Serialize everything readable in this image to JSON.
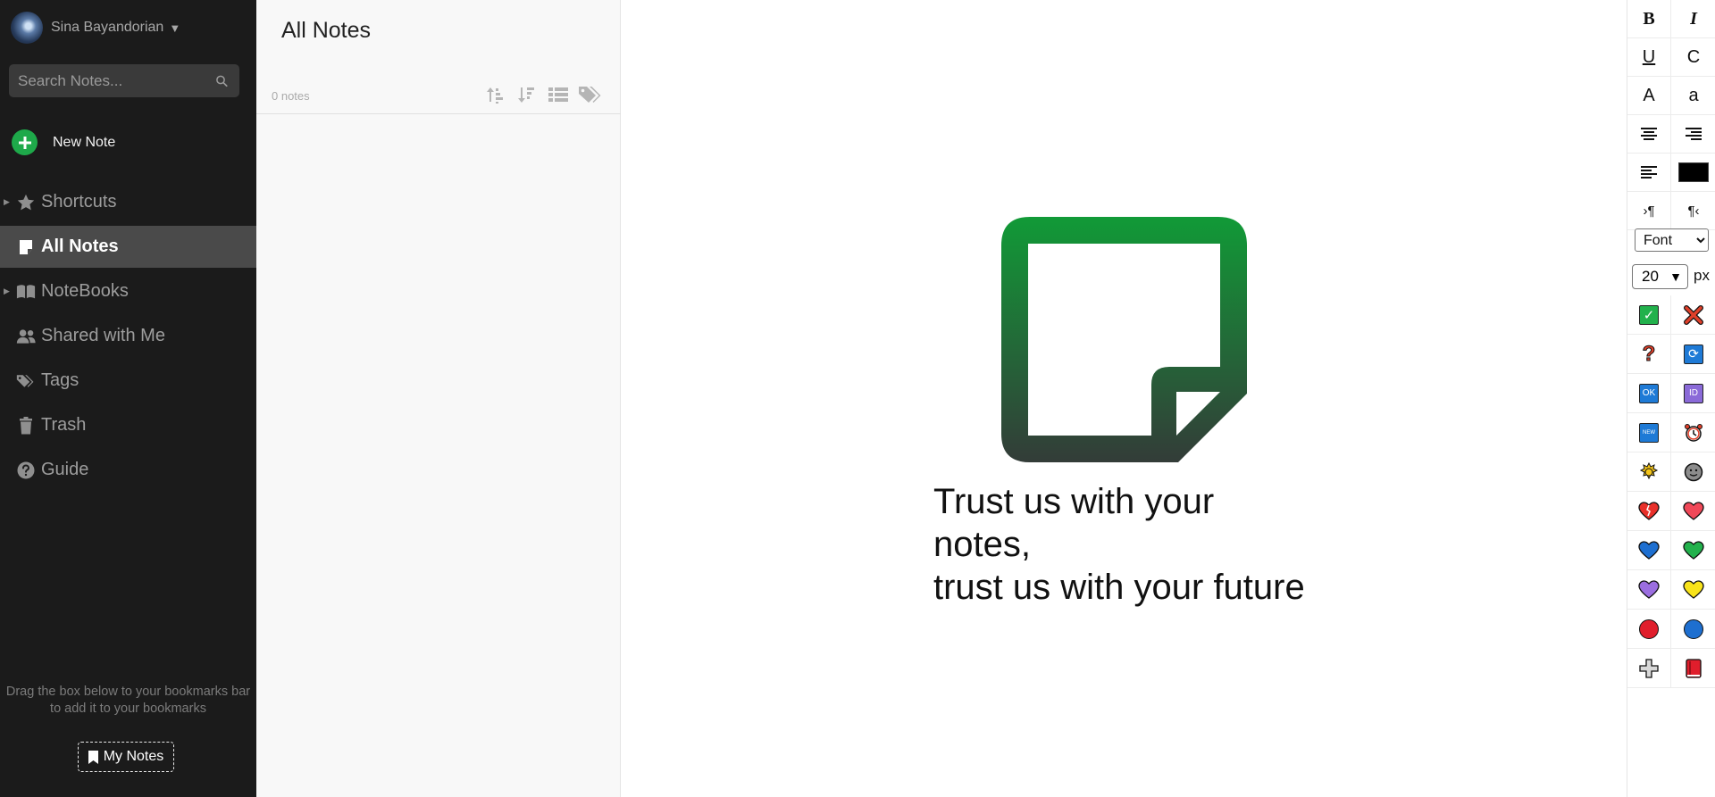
{
  "user": {
    "name": "Sina Bayandorian",
    "caret": "▼"
  },
  "search": {
    "placeholder": "Search Notes..."
  },
  "new_note": {
    "label": "New Note"
  },
  "nav": [
    {
      "label": "Shortcuts",
      "icon": "star-icon",
      "expandable": true,
      "active": false
    },
    {
      "label": "All Notes",
      "icon": "note-icon",
      "expandable": false,
      "active": true
    },
    {
      "label": "NoteBooks",
      "icon": "book-icon",
      "expandable": true,
      "active": false
    },
    {
      "label": "Shared with Me",
      "icon": "users-icon",
      "expandable": false,
      "active": false
    },
    {
      "label": "Tags",
      "icon": "tags-icon",
      "expandable": false,
      "active": false
    },
    {
      "label": "Trash",
      "icon": "trash-icon",
      "expandable": false,
      "active": false
    },
    {
      "label": "Guide",
      "icon": "question-circle-icon",
      "expandable": false,
      "active": false
    }
  ],
  "bookmark": {
    "hint": "Drag the box below to your bookmarks bar to add it to your bookmarks",
    "button_label": "My Notes"
  },
  "list": {
    "title": "All Notes",
    "count": "0 notes",
    "tools": [
      "sort-ascending-icon",
      "sort-descending-icon",
      "list-view-icon",
      "tags-icon"
    ]
  },
  "main": {
    "headline_line1": "Trust us with your notes,",
    "headline_line2": "trust us with your future",
    "accent_top": "#119a37",
    "accent_bottom": "#333c38"
  },
  "toolbar": {
    "bold": "B",
    "italic": "I",
    "underline": "U",
    "clear": "C",
    "uppercase": "A",
    "lowercase": "a",
    "font_placeholder": "Font",
    "font_size": "20",
    "font_size_unit": "px",
    "color_swatch": "#000000",
    "ok_label": "OK",
    "id_label": "ID",
    "new_label": "NEW"
  }
}
